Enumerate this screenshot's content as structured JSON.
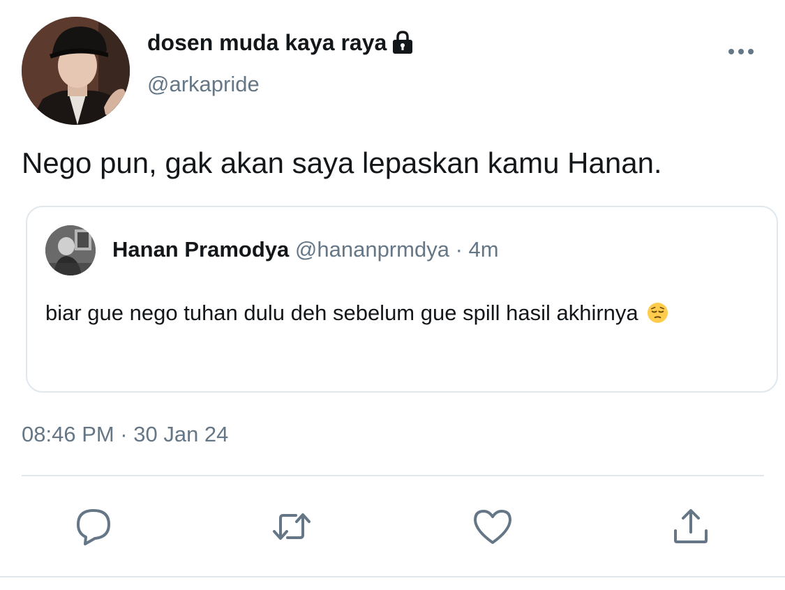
{
  "author": {
    "display_name": "dosen muda kaya raya",
    "handle": "@arkapride",
    "protected_icon": "lock-icon"
  },
  "tweet": {
    "text": "Nego pun, gak akan saya lepaskan kamu Hanan.",
    "timestamp": "08:46 PM · 30 Jan 24"
  },
  "quoted_tweet": {
    "display_name": "Hanan Pramodya",
    "handle": "@hananprmdya",
    "separator": "·",
    "time": "4m",
    "text": "biar gue nego tuhan dulu deh sebelum gue spill hasil akhirnya",
    "emoji": "pensive-face-emoji"
  },
  "actions": {
    "reply_icon": "reply-icon",
    "retweet_icon": "retweet-icon",
    "like_icon": "heart-icon",
    "share_icon": "share-icon"
  },
  "colors": {
    "primary_text": "#14171a",
    "secondary_text": "#657786",
    "border": "#e1e8ed",
    "icon": "#657786"
  }
}
